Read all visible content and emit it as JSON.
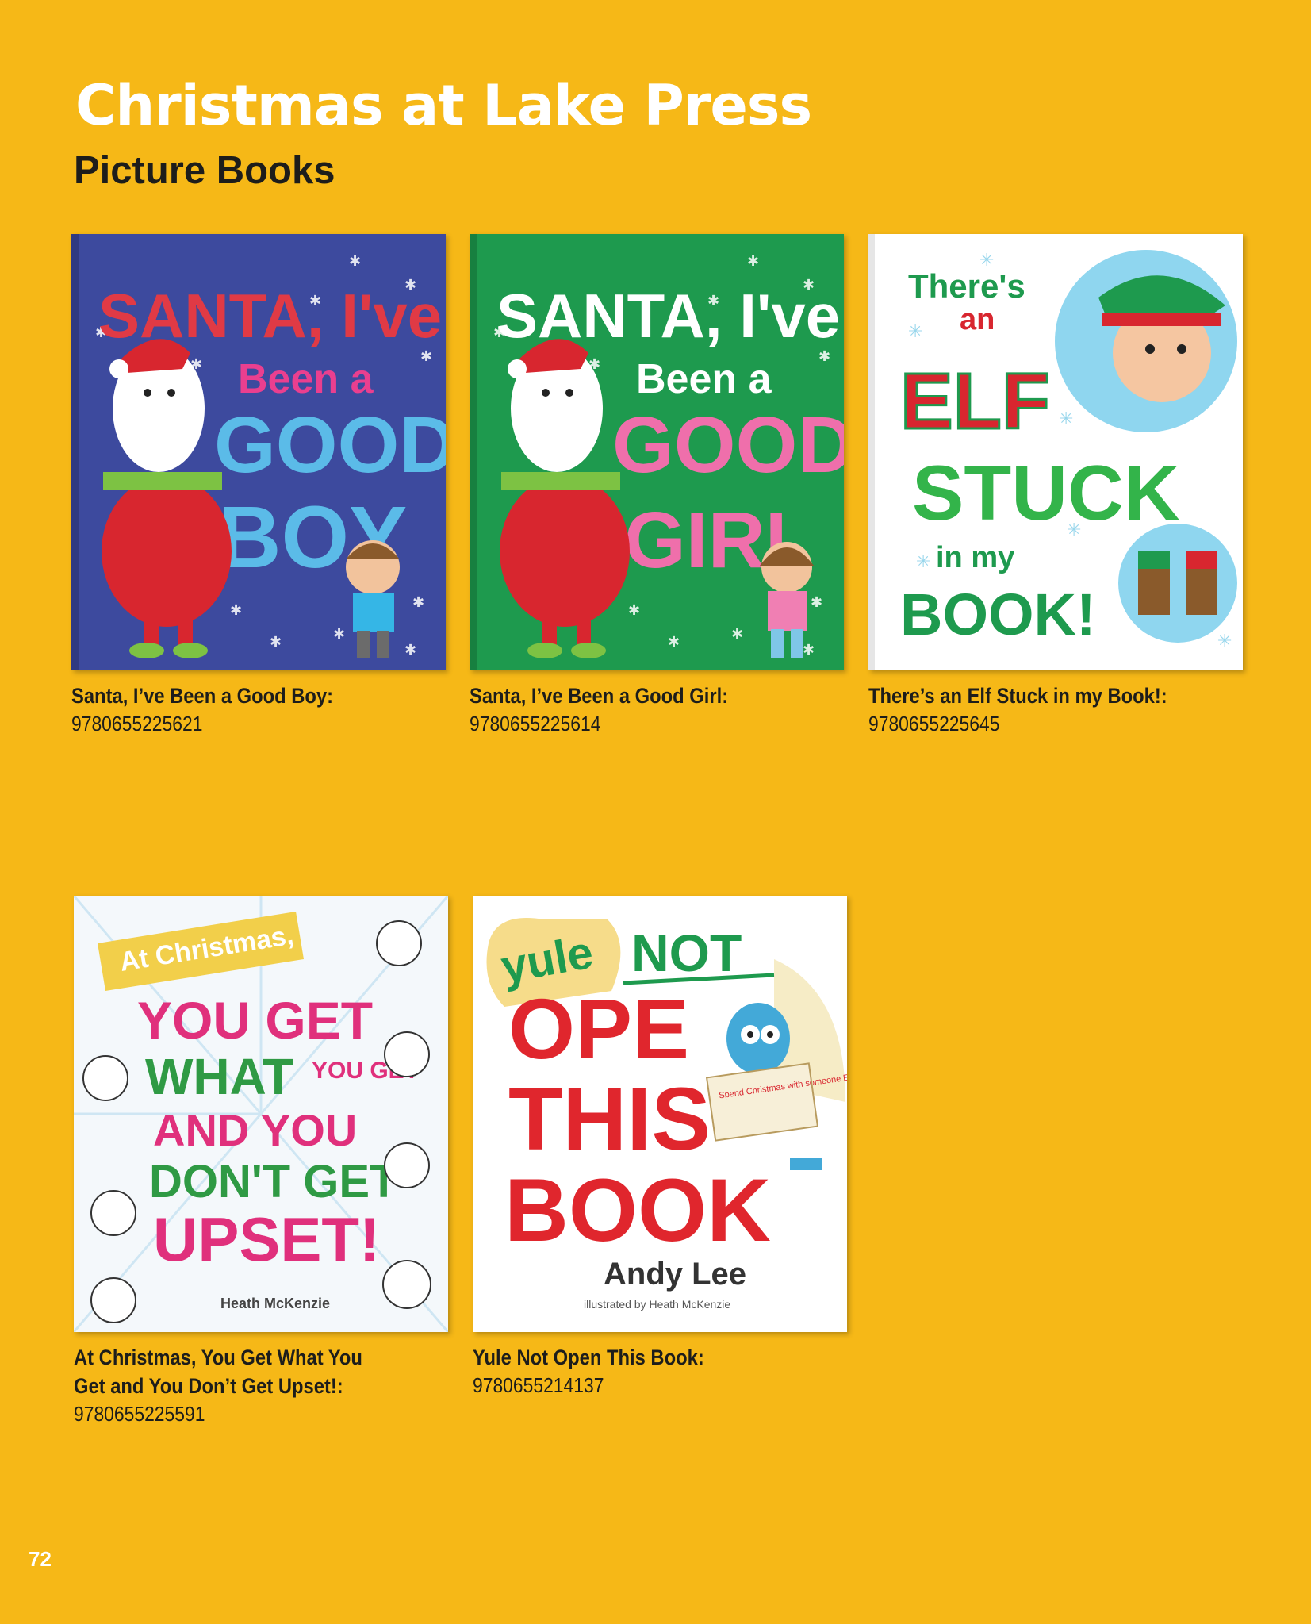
{
  "header": {
    "title": "Christmas at Lake Press",
    "subtitle": "Picture Books"
  },
  "books": [
    {
      "title": "Santa, I’ve Been a Good Boy:",
      "isbn": "9780655225621",
      "cover": {
        "line1": "SANTA, I've",
        "line2": "Been a",
        "line3": "GOOD",
        "line4": "BOY",
        "background": "#3d4a9e"
      }
    },
    {
      "title": "Santa, I’ve Been a Good Girl:",
      "isbn": "9780655225614",
      "cover": {
        "line1": "SANTA, I've",
        "line2": "Been a",
        "line3": "GOOD",
        "line4": "GIRL",
        "background": "#1e9a4e"
      }
    },
    {
      "title": "There’s an Elf Stuck in my Book!:",
      "isbn": "9780655225645",
      "cover": {
        "line1": "There's",
        "line2": "an",
        "line3": "ELF",
        "line4": "STUCK",
        "line5": "in my",
        "line6": "BOOK!",
        "background": "#ffffff"
      }
    },
    {
      "title": "At Christmas, You Get What You\nGet and You Don’t Get Upset!:",
      "isbn": "9780655225591",
      "cover": {
        "banner": "At Christmas,",
        "line1": "YOU GET",
        "line2": "WHAT",
        "line2b": "YOU GET",
        "line3": "AND YOU",
        "line4": "DON'T GET",
        "line5": "UPSET!",
        "author": "Heath McKenzie",
        "background": "#f4f8fb"
      }
    },
    {
      "title": "Yule Not Open This Book:",
      "isbn": "9780655214137",
      "cover": {
        "bubble": "yule",
        "line0": "NOT",
        "line1": "OPE",
        "line2": "THIS",
        "line3": "BOOK",
        "sign": "Spend Christmas with someone Else!!",
        "author": "Andy Lee",
        "illustrator": "illustrated by Heath McKenzie",
        "background": "#ffffff"
      }
    }
  ],
  "footer": {
    "page_number": "72"
  },
  "colors": {
    "page_background": "#f6b817",
    "title_text": "#ffffff",
    "body_text": "#1d1d1b"
  }
}
